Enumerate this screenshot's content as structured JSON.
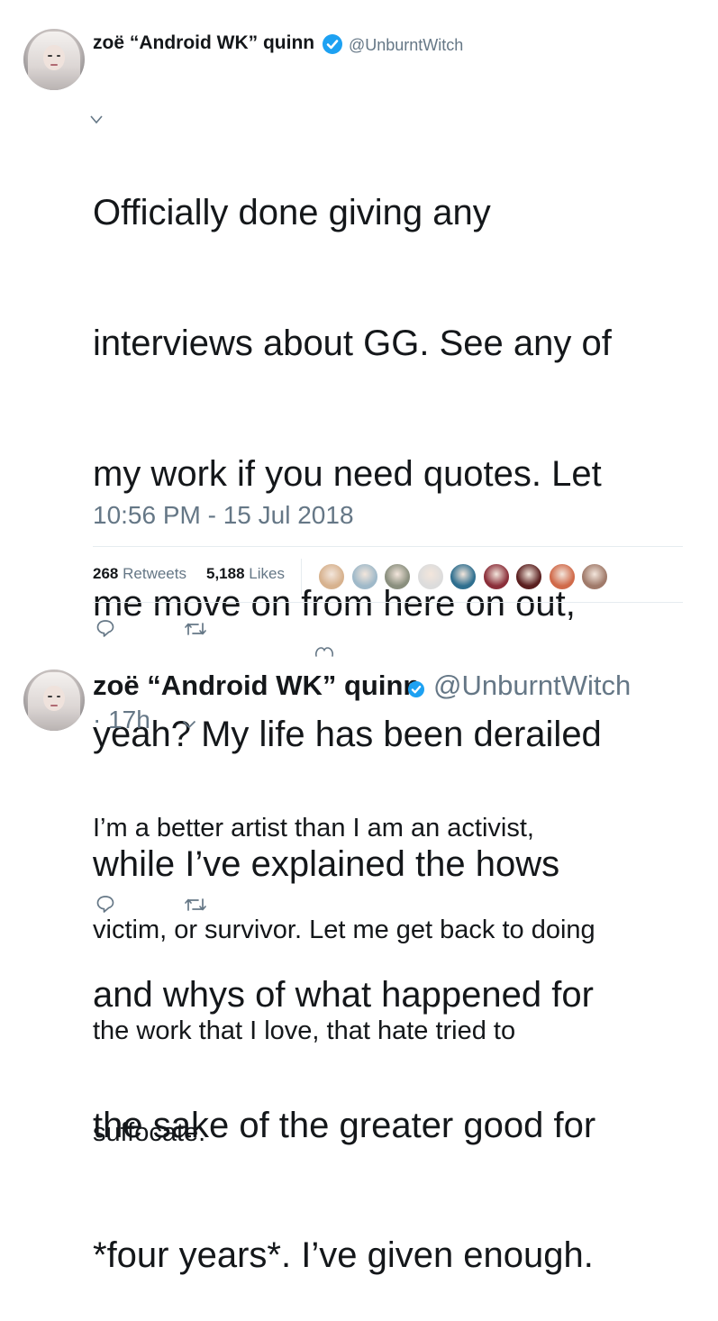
{
  "main_tweet": {
    "author_name": "zoë “Android WK” quinn",
    "handle": "@UnburntWitch",
    "text_lines": [
      "Officially done giving any",
      "interviews about GG. See any of",
      "my work if you need quotes. Let",
      "me move on from here on out,",
      "yeah? My life has been derailed",
      "while I’ve explained the hows",
      "and whys of what happened for",
      "the sake of the greater good for",
      "*four years*. I’ve given enough."
    ],
    "timestamp": "10:56 PM - 15 Jul 2018",
    "retweets_count": "268",
    "retweets_label": "Retweets",
    "likes_count": "5,188",
    "likes_label": "Likes",
    "liker_avatar_colors": [
      "#d7b28e",
      "#9fb9c9",
      "#8a8f7e",
      "#dcdcdc",
      "#2f6f8f",
      "#8b2f3a",
      "#5a1f1f",
      "#d06a4a",
      "#a07a6a"
    ]
  },
  "reply_tweet": {
    "author_name": "zoë “Android WK” quinn",
    "handle": "@UnburntWitch",
    "time": "· 17h",
    "text_lines": [
      "I’m a better artist than I am an activist,",
      "victim, or survivor. Let me get back to doing",
      "the work that I love, that hate tried to",
      "suffocate."
    ]
  },
  "icons": {
    "reply": "reply-icon",
    "retweet": "retweet-icon",
    "like": "heart-icon",
    "verified": "verified-badge-icon",
    "caret": "chevron-down-icon"
  },
  "colors": {
    "text": "#14171a",
    "muted": "#657786",
    "verified": "#1da1f2",
    "divider": "#e6ecf0"
  }
}
